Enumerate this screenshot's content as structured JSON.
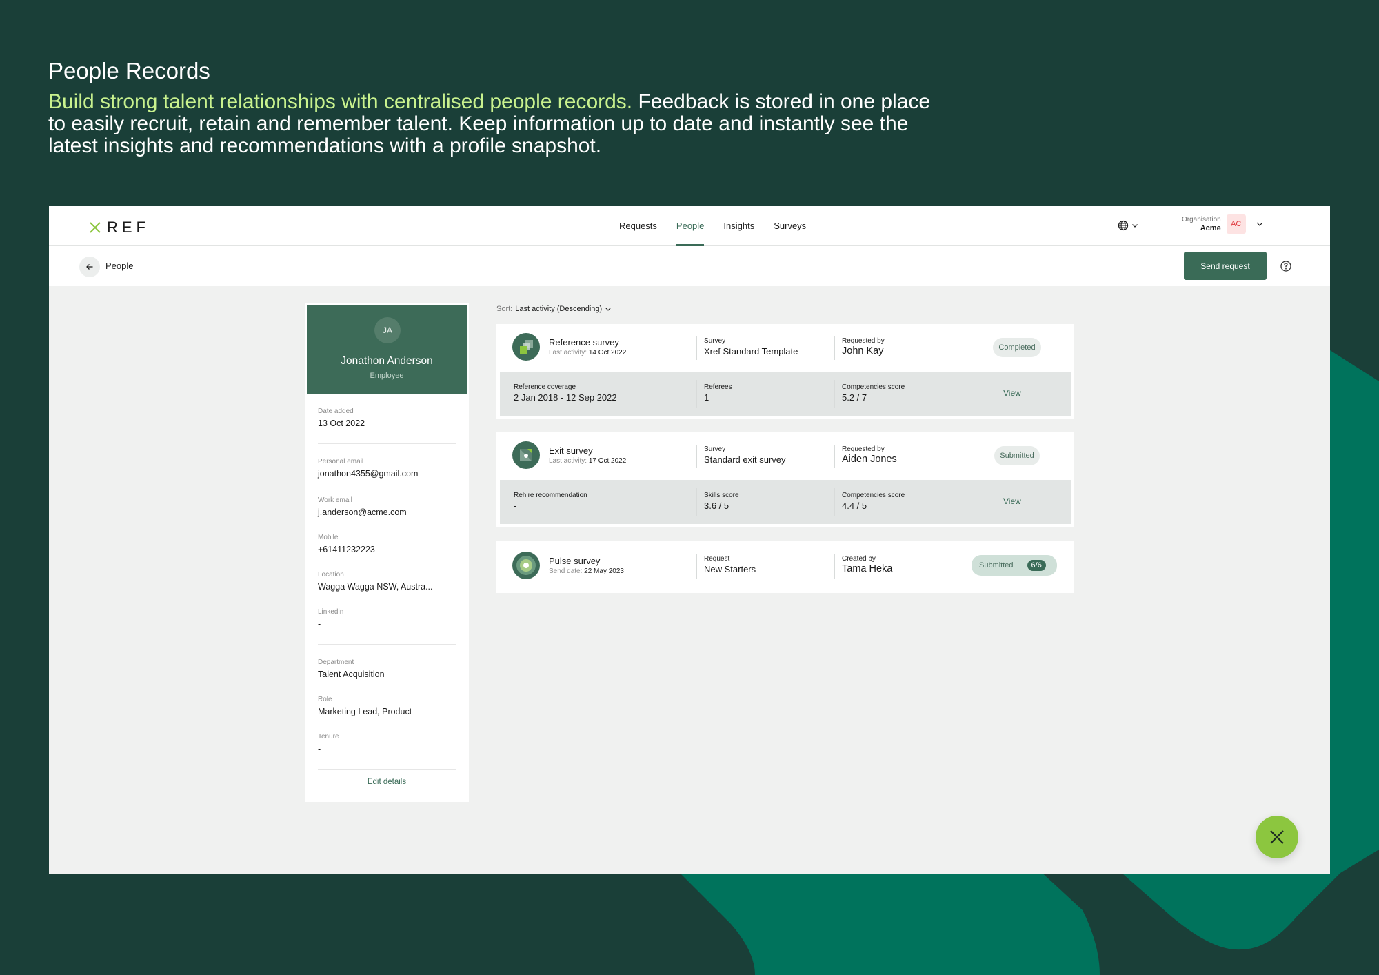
{
  "hero": {
    "title": "People Records",
    "accent_text": "Build strong talent relationships with centralised people records.",
    "body_text": " Feedback is stored in one place to easily recruit, retain and remember talent. Keep information up to date and instantly see the latest insights and recommendations with a profile snapshot."
  },
  "colors": {
    "background": "#1a3f38",
    "accent_green": "#c9f28e",
    "brand_green": "#3a6b57",
    "decor_green": "#00735c",
    "fab_green": "#8cc63f"
  },
  "topnav": {
    "logo_text": "REF",
    "tabs": [
      {
        "label": "Requests",
        "active": false
      },
      {
        "label": "People",
        "active": true
      },
      {
        "label": "Insights",
        "active": false
      },
      {
        "label": "Surveys",
        "active": false
      }
    ],
    "language_icon": "globe-icon",
    "org_label": "Organisation",
    "org_name": "Acme",
    "org_initials": "AC"
  },
  "subbar": {
    "title": "People",
    "send_request_label": "Send request"
  },
  "profile": {
    "initials": "JA",
    "name": "Jonathon Anderson",
    "type": "Employee",
    "date_added_label": "Date added",
    "date_added": "13 Oct 2022",
    "personal_email_label": "Personal email",
    "personal_email": "jonathon4355@gmail.com",
    "work_email_label": "Work email",
    "work_email": "j.anderson@acme.com",
    "mobile_label": "Mobile",
    "mobile": "+61411232223",
    "location_label": "Location",
    "location": "Wagga Wagga NSW, Austra...",
    "linkedin_label": "Linkedin",
    "linkedin": "-",
    "department_label": "Department",
    "department": "Talent Acquisition",
    "role_label": "Role",
    "role": "Marketing Lead, Product",
    "tenure_label": "Tenure",
    "tenure": "-",
    "edit_label": "Edit details"
  },
  "sort": {
    "label": "Sort:",
    "value": "Last activity (Descending)"
  },
  "surveys": [
    {
      "title": "Reference survey",
      "meta_label": "Last activity:",
      "meta_value": "14 Oct 2022",
      "col1_label": "Survey",
      "col1_value": "Xref Standard Template",
      "col2_label": "Requested by",
      "col2_value": "John Kay",
      "status": "Completed",
      "sub": [
        {
          "label": "Reference coverage",
          "value": "2 Jan 2018 - 12 Sep 2022"
        },
        {
          "label": "Referees",
          "value": "1"
        },
        {
          "label": "Competencies score",
          "value": "5.2 / 7"
        }
      ],
      "action": "View"
    },
    {
      "title": "Exit survey",
      "meta_label": "Last activity:",
      "meta_value": "17 Oct 2022",
      "col1_label": "Survey",
      "col1_value": "Standard exit survey",
      "col2_label": "Requested by",
      "col2_value": "Aiden Jones",
      "status": "Submitted",
      "sub": [
        {
          "label": "Rehire recommendation",
          "value": "-"
        },
        {
          "label": "Skills score",
          "value": "3.6 / 5"
        },
        {
          "label": "Competencies score",
          "value": "4.4 / 5"
        }
      ],
      "action": "View"
    },
    {
      "title": "Pulse survey",
      "meta_label": "Send date:",
      "meta_value": "22 May 2023",
      "col1_label": "Request",
      "col1_value": "New Starters",
      "col2_label": "Created by",
      "col2_value": "Tama Heka",
      "status": "Submitted",
      "count": "6/6"
    }
  ]
}
